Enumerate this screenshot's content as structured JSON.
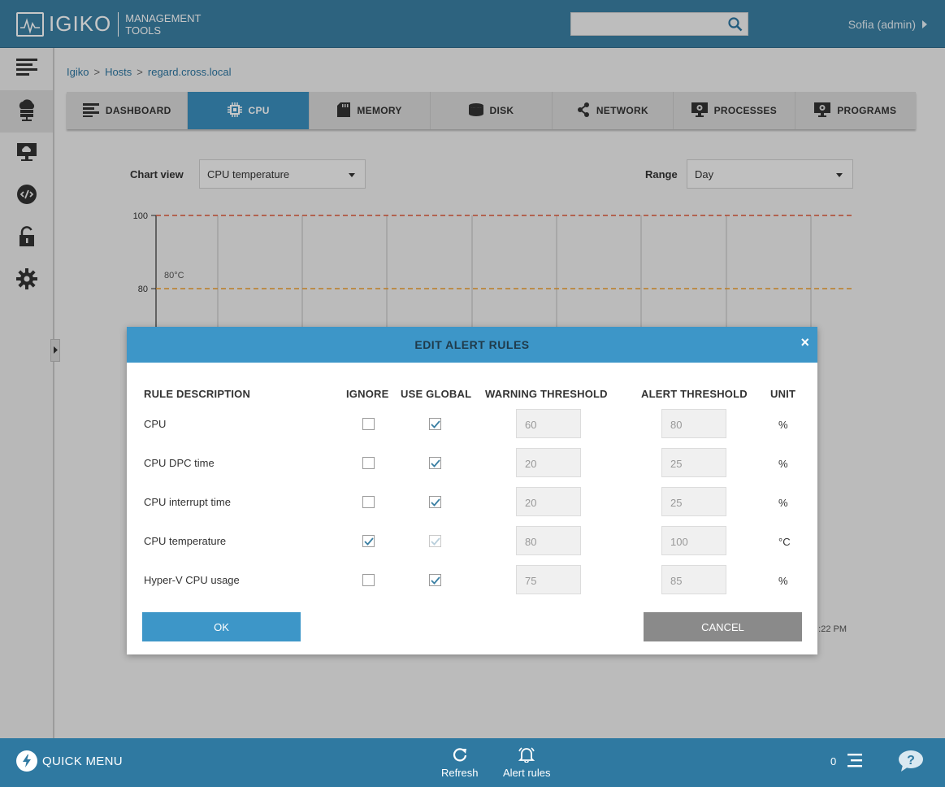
{
  "header": {
    "brand": "IGIKO",
    "tagline_line1": "MANAGEMENT",
    "tagline_line2": "TOOLS",
    "search_placeholder": "",
    "user": "Sofia (admin)"
  },
  "sidebar": {
    "items": [
      {
        "icon": "menu-icon"
      },
      {
        "icon": "cloud-server-icon",
        "active": true
      },
      {
        "icon": "remote-desktop-icon"
      },
      {
        "icon": "remote-connect-icon"
      },
      {
        "icon": "lock-icon"
      },
      {
        "icon": "gear-icon"
      }
    ]
  },
  "breadcrumb": [
    "Igiko",
    "Hosts",
    "regard.cross.local"
  ],
  "breadcrumb_sep": ">",
  "tabs": [
    {
      "label": "DASHBOARD",
      "icon": "dashboard-icon"
    },
    {
      "label": "CPU",
      "icon": "cpu-icon",
      "active": true
    },
    {
      "label": "MEMORY",
      "icon": "memory-icon"
    },
    {
      "label": "DISK",
      "icon": "disk-icon"
    },
    {
      "label": "NETWORK",
      "icon": "network-icon"
    },
    {
      "label": "PROCESSES",
      "icon": "processes-icon"
    },
    {
      "label": "PROGRAMS",
      "icon": "programs-icon"
    }
  ],
  "controls": {
    "chart_view_label": "Chart view",
    "chart_view_value": "CPU temperature",
    "range_label": "Range",
    "range_value": "Day"
  },
  "chart_data": {
    "type": "line",
    "y_ticks": [
      "100",
      "80"
    ],
    "threshold_label": "80°C",
    "thresholds": [
      {
        "value": 100,
        "color": "#e05a3a"
      },
      {
        "value": 80,
        "color": "#f0a030"
      }
    ],
    "visible_time_label": ":22 PM"
  },
  "modal": {
    "title": "EDIT ALERT RULES",
    "close": "×",
    "columns": {
      "description": "RULE DESCRIPTION",
      "ignore": "IGNORE",
      "use_global": "USE GLOBAL",
      "warning": "WARNING THRESHOLD",
      "alert": "ALERT THRESHOLD",
      "unit": "UNIT"
    },
    "rules": [
      {
        "description": "CPU",
        "ignore": false,
        "use_global": true,
        "use_global_disabled": false,
        "warning": "60",
        "alert": "80",
        "unit": "%"
      },
      {
        "description": "CPU DPC time",
        "ignore": false,
        "use_global": true,
        "use_global_disabled": false,
        "warning": "20",
        "alert": "25",
        "unit": "%"
      },
      {
        "description": "CPU interrupt time",
        "ignore": false,
        "use_global": true,
        "use_global_disabled": false,
        "warning": "20",
        "alert": "25",
        "unit": "%"
      },
      {
        "description": "CPU temperature",
        "ignore": true,
        "use_global": true,
        "use_global_disabled": true,
        "warning": "80",
        "alert": "100",
        "unit": "°C"
      },
      {
        "description": "Hyper-V CPU usage",
        "ignore": false,
        "use_global": true,
        "use_global_disabled": false,
        "warning": "75",
        "alert": "85",
        "unit": "%"
      }
    ],
    "ok_label": "OK",
    "cancel_label": "CANCEL"
  },
  "bottombar": {
    "quick_menu": "QUICK MENU",
    "refresh": "Refresh",
    "alert_rules": "Alert rules",
    "notification_count": "0"
  },
  "colors": {
    "primary": "#3a7fa3",
    "accent": "#3d96c8",
    "cancel": "#8a8a8a"
  }
}
